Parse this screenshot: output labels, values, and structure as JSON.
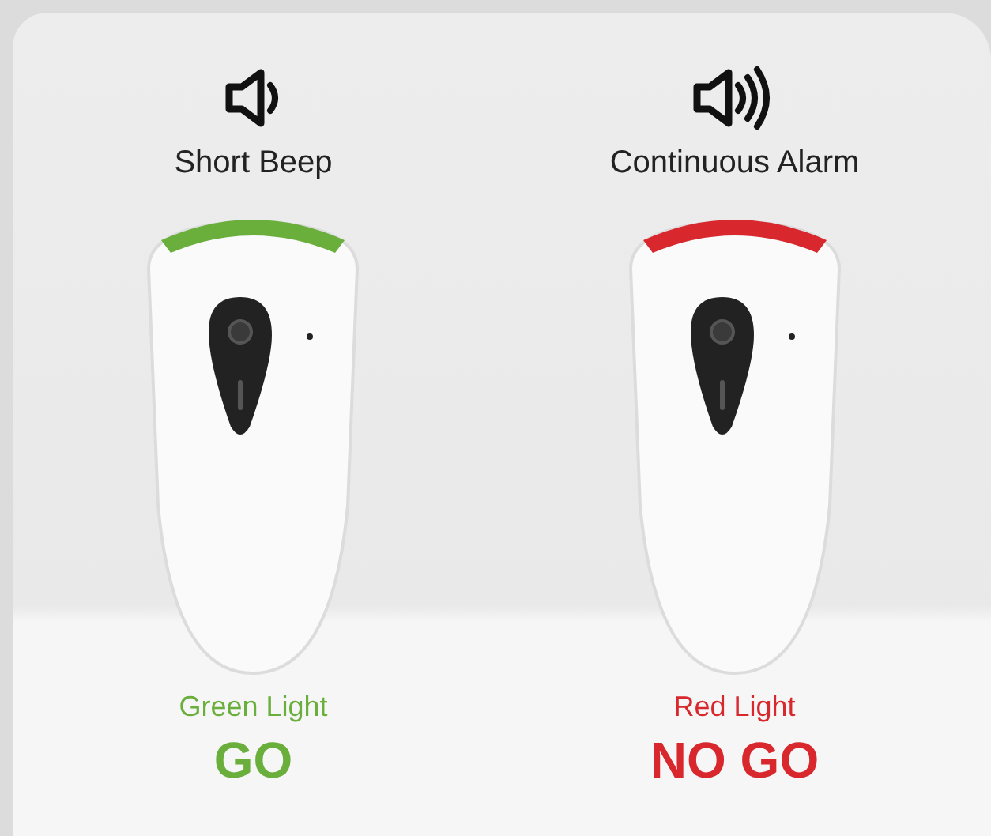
{
  "columns": [
    {
      "kind": "short",
      "sound": "Short Beep",
      "color": "#6aae3c",
      "light": "Green Light",
      "status": "GO"
    },
    {
      "kind": "continuous",
      "sound": "Continuous Alarm",
      "color": "#d8282e",
      "light": "Red Light",
      "status": "NO GO"
    }
  ]
}
